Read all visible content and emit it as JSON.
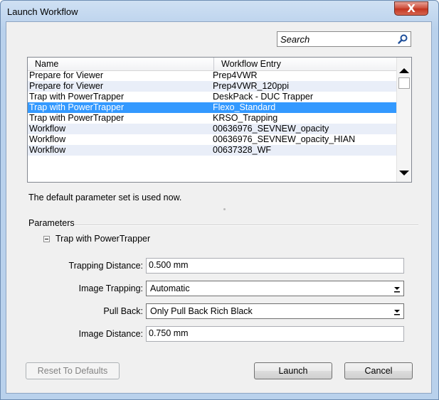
{
  "window": {
    "title": "Launch Workflow",
    "close_label": "X"
  },
  "search": {
    "placeholder": "Search"
  },
  "list": {
    "columns": [
      "Name",
      "Workflow Entry"
    ],
    "rows": [
      {
        "name": "Prepare for Viewer",
        "entry": "Prep4VWR",
        "selected": false
      },
      {
        "name": "Prepare for Viewer",
        "entry": "Prep4VWR_120ppi",
        "selected": false
      },
      {
        "name": "Trap with PowerTrapper",
        "entry": "DeskPack - DUC Trapper",
        "selected": false
      },
      {
        "name": "Trap with PowerTrapper",
        "entry": "Flexo_Standard",
        "selected": true
      },
      {
        "name": "Trap with PowerTrapper",
        "entry": "KRSO_Trapping",
        "selected": false
      },
      {
        "name": "Workflow",
        "entry": "00636976_SEVNEW_opacity",
        "selected": false
      },
      {
        "name": "Workflow",
        "entry": "00636976_SEVNEW_opacity_HIAN",
        "selected": false
      },
      {
        "name": "Workflow",
        "entry": "00637328_WF",
        "selected": false
      }
    ]
  },
  "status_text": "The default parameter set is used now.",
  "parameters": {
    "group_label": "Parameters",
    "tree_node": "Trap with PowerTrapper",
    "trapping_distance": {
      "label": "Trapping Distance:",
      "value": "0.500 mm"
    },
    "image_trapping": {
      "label": "Image Trapping:",
      "value": "Automatic"
    },
    "pull_back": {
      "label": "Pull Back:",
      "value": "Only Pull Back Rich Black"
    },
    "image_distance": {
      "label": "Image Distance:",
      "value": "0.750 mm"
    }
  },
  "buttons": {
    "reset": "Reset To Defaults",
    "launch": "Launch",
    "cancel": "Cancel"
  },
  "colors": {
    "selection": "#3399ff",
    "alt_row": "#e9eef8",
    "frame": "#b9d1ec",
    "close": "#c2331f"
  },
  "icons": {
    "search": "magnifier-icon",
    "close": "close-icon",
    "dropdown": "chevron-down-icon"
  }
}
